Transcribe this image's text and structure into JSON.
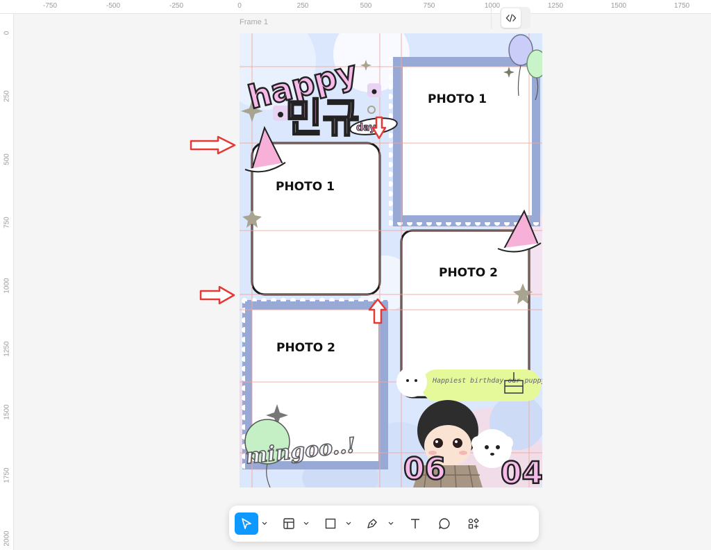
{
  "ruler": {
    "top_labels": [
      "-750",
      "-500",
      "-250",
      "0",
      "250",
      "500",
      "750",
      "1000",
      "1250",
      "1500",
      "1750"
    ],
    "left_labels": [
      "0",
      "250",
      "500",
      "750",
      "1000",
      "1250",
      "1500",
      "1750",
      "2000"
    ]
  },
  "frame": {
    "name": "Frame 1",
    "title_happy": "happy",
    "title_name": "민규",
    "title_day": "day",
    "photos": [
      "PHOTO 1",
      "PHOTO 1",
      "PHOTO 2",
      "PHOTO 2"
    ],
    "speech": "Happiest birthday our puppy...!",
    "signature": "mingoo..!",
    "date_month": "06",
    "date_day": "04"
  },
  "toolbar": {
    "tools": [
      "move-tool",
      "frame-tool",
      "shape-tool",
      "pen-tool",
      "text-tool",
      "comment-tool",
      "actions-tool"
    ],
    "active": "move-tool",
    "dev_mode": "dev-mode-toggle"
  },
  "colors": {
    "accent": "#0d99ff",
    "arrow": "#e53935",
    "frame_bg": "#d9e6fb",
    "stamp": "#98a9d6",
    "title_pink": "#f7b8ea",
    "guide": "#f4a79a"
  }
}
